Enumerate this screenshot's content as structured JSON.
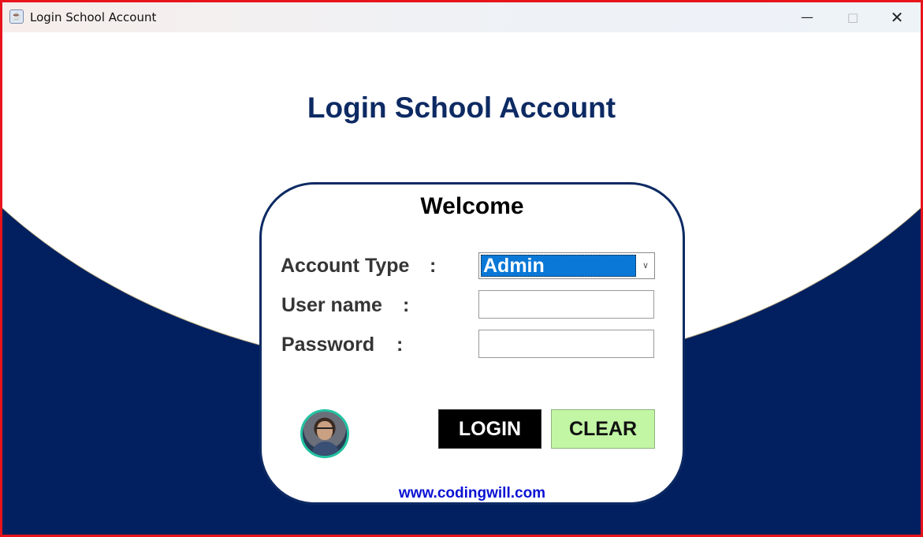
{
  "window": {
    "title": "Login School Account",
    "controls": {
      "minimize": "—",
      "maximize": "□",
      "close": "✕"
    },
    "icon": "java-cup-icon"
  },
  "page": {
    "title": "Login School Account"
  },
  "card": {
    "welcome": "Welcome",
    "fields": {
      "account_type": {
        "label": "Account Type",
        "separator": ":",
        "value": "Admin"
      },
      "username": {
        "label": "User name",
        "separator": ":",
        "value": ""
      },
      "password": {
        "label": "Password",
        "separator": ":",
        "value": ""
      }
    },
    "buttons": {
      "login": "LOGIN",
      "clear": "CLEAR"
    },
    "website": "www.codingwill.com"
  },
  "colors": {
    "frame_border": "#e8141c",
    "navy_background": "#02205f",
    "title_text": "#0d2a63",
    "select_highlight": "#0a78d7",
    "login_button": "#000000",
    "clear_button": "#c2f5a4",
    "link": "#0a12d4"
  }
}
